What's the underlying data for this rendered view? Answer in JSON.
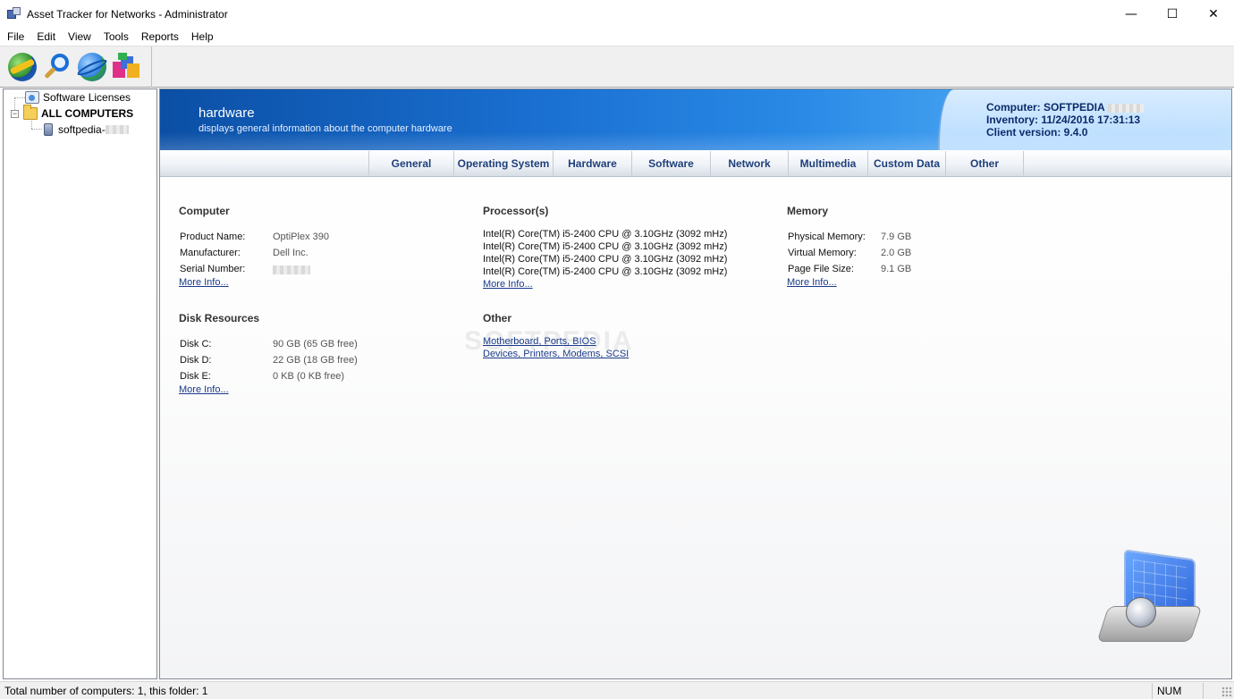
{
  "window": {
    "title": "Asset Tracker for Networks - Administrator",
    "minimize": "—",
    "maximize": "☐",
    "close": "✕"
  },
  "menu": [
    "File",
    "Edit",
    "View",
    "Tools",
    "Reports",
    "Help"
  ],
  "toolbar": {
    "buttons": [
      "network-inventory-icon",
      "search-icon",
      "internet-icon",
      "software-packages-icon"
    ]
  },
  "tree": {
    "software_licenses": "Software Licenses",
    "all_computers": "ALL COMPUTERS",
    "computer": "softpedia-",
    "expander": "−"
  },
  "banner": {
    "title": "hardware",
    "description": "displays general information about the computer hardware",
    "computer": "Computer: SOFTPEDIA",
    "inventory": "Inventory: 11/24/2016 17:31:13",
    "client_version": "Client version: 9.4.0"
  },
  "tabs": [
    "General",
    "Operating System",
    "Hardware",
    "Software",
    "Network",
    "Multimedia",
    "Custom Data",
    "Other"
  ],
  "computer": {
    "title": "Computer",
    "product_name_label": "Product Name:",
    "product_name": "OptiPlex 390",
    "manufacturer_label": "Manufacturer:",
    "manufacturer": "Dell Inc.",
    "serial_label": "Serial Number:",
    "more_info": "More Info..."
  },
  "processors": {
    "title": "Processor(s)",
    "lines": [
      "Intel(R) Core(TM) i5-2400 CPU @ 3.10GHz (3092 mHz)",
      "Intel(R) Core(TM) i5-2400 CPU @ 3.10GHz (3092 mHz)",
      "Intel(R) Core(TM) i5-2400 CPU @ 3.10GHz (3092 mHz)",
      "Intel(R) Core(TM) i5-2400 CPU @ 3.10GHz (3092 mHz)"
    ],
    "more_info": "More Info..."
  },
  "memory": {
    "title": "Memory",
    "physical_label": "Physical Memory:",
    "physical": "7.9 GB",
    "virtual_label": "Virtual Memory:",
    "virtual": "2.0 GB",
    "pagefile_label": "Page File Size:",
    "pagefile": "9.1 GB",
    "more_info": "More Info..."
  },
  "disks": {
    "title": "Disk Resources",
    "c_label": "Disk C:",
    "c": "90 GB (65 GB free)",
    "d_label": "Disk D:",
    "d": "22 GB (18 GB free)",
    "e_label": "Disk E:",
    "e": "0 KB (0 KB free)",
    "more_info": "More Info..."
  },
  "other": {
    "title": "Other",
    "link1": "Motherboard, Ports, BIOS",
    "link2": "Devices, Printers, Modems, SCSI"
  },
  "watermark": "SOFTPEDIA",
  "status": {
    "text": "Total number of computers: 1, this folder: 1",
    "num": "NUM"
  }
}
